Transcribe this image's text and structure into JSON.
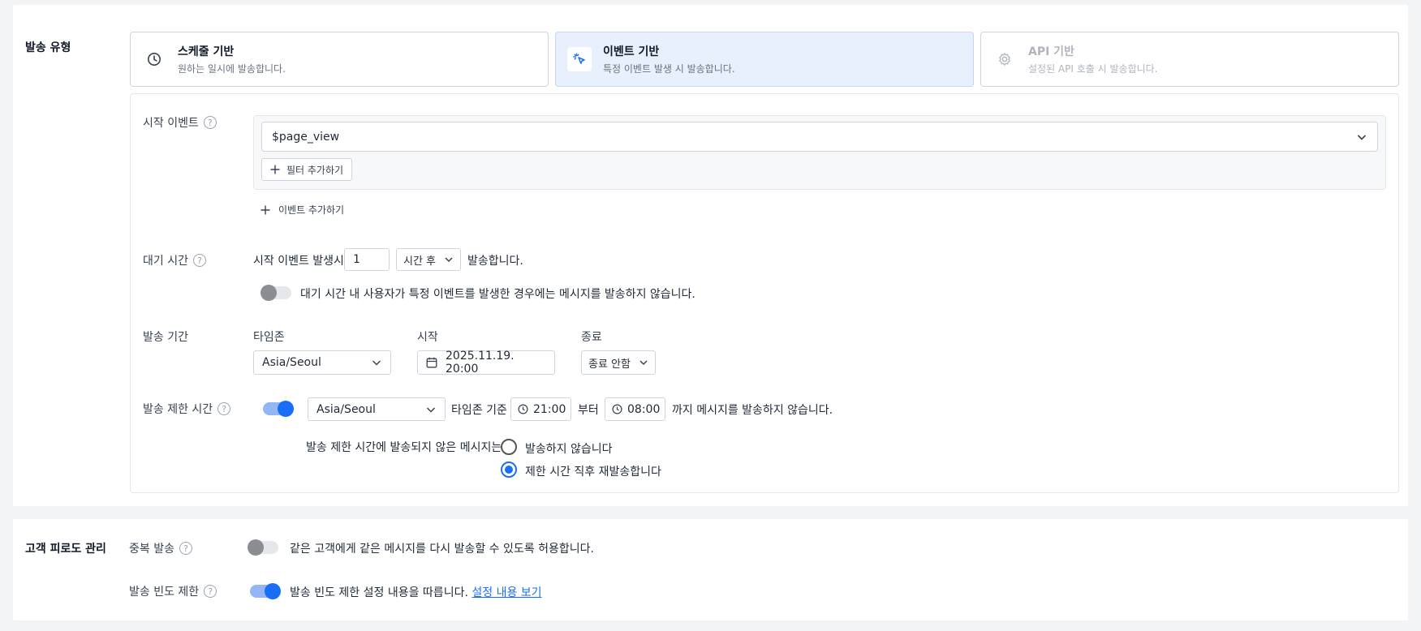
{
  "send_type": {
    "section_title": "발송 유형",
    "options": [
      {
        "title": "스케줄 기반",
        "desc": "원하는 일시에 발송합니다.",
        "icon": "clock-icon",
        "state": "default"
      },
      {
        "title": "이벤트 기반",
        "desc": "특정 이벤트 발생 시 발송합니다.",
        "icon": "cursor-click-icon",
        "state": "selected"
      },
      {
        "title": "API 기반",
        "desc": "설정된 API 호출 시 발송합니다.",
        "icon": "gear-icon",
        "state": "disabled"
      }
    ]
  },
  "start_event": {
    "label": "시작 이벤트",
    "selected": "$page_view",
    "add_filter": "필터 추가하기",
    "add_event": "이벤트 추가하기"
  },
  "wait_time": {
    "label": "대기 시간",
    "prefix": "시작 이벤트 발생시",
    "value": "1",
    "unit": "시간 후",
    "suffix": "발송합니다.",
    "toggle_text": "대기 시간 내 사용자가 특정 이벤트를 발생한 경우에는 메시지를 발송하지 않습니다.",
    "toggle_on": false
  },
  "send_period": {
    "label": "발송 기간",
    "timezone_label": "타임존",
    "timezone": "Asia/Seoul",
    "start_label": "시작",
    "start": "2025.11.19. 20:00",
    "end_label": "종료",
    "end": "종료 안함"
  },
  "restrict_time": {
    "label": "발송 제한 시간",
    "toggle_on": true,
    "timezone": "Asia/Seoul",
    "tz_basis": "타임존 기준",
    "from": "21:00",
    "from_suffix": "부터",
    "to": "08:00",
    "to_suffix": "까지 메시지를 발송하지 않습니다.",
    "unsent_label": "발송 제한 시간에 발송되지 않은 메시지는",
    "options": [
      {
        "label": "발송하지 않습니다",
        "checked": false
      },
      {
        "label": "제한 시간 직후 재발송합니다",
        "checked": true
      }
    ]
  },
  "fatigue": {
    "section_title": "고객 피로도 관리",
    "duplicate": {
      "label": "중복 발송",
      "toggle_on": false,
      "text": "같은 고객에게 같은 메시지를 다시 발송할 수 있도록 허용합니다."
    },
    "frequency": {
      "label": "발송 빈도 제한",
      "toggle_on": true,
      "text": "발송 빈도 제한 설정 내용을 따릅니다.",
      "link": "설정 내용 보기"
    }
  },
  "colors": {
    "accent": "#1a6ef5",
    "selected_bg": "#e8f0fe"
  }
}
